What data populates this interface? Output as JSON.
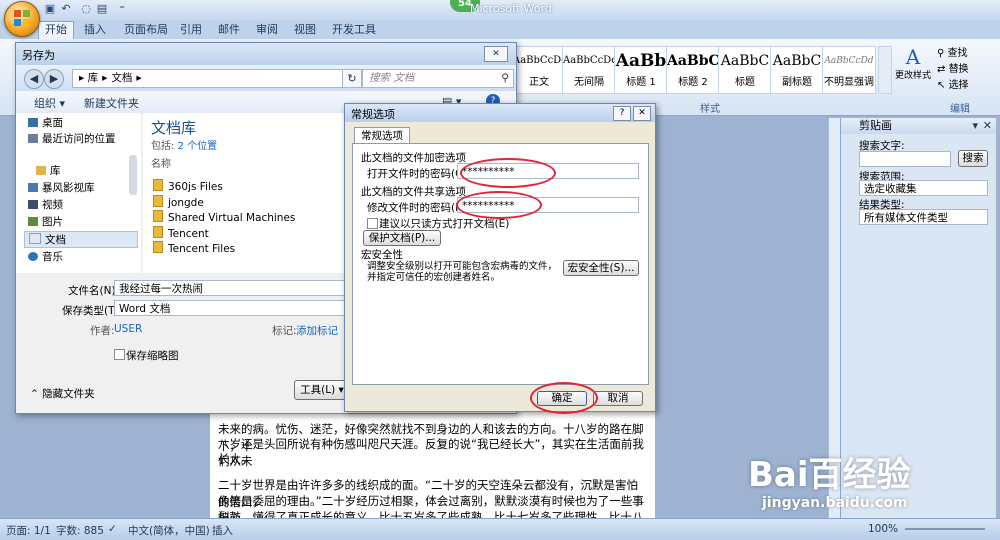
{
  "app": {
    "title": "Microsoft Word",
    "badge": "54"
  },
  "ribbon": {
    "tabs": [
      "开始",
      "插入",
      "页面布局",
      "引用",
      "邮件",
      "审阅",
      "视图",
      "开发工具"
    ],
    "styles": [
      {
        "sample": "AaBbCcDd",
        "name": "正文"
      },
      {
        "sample": "AaBbCcDd",
        "name": "无间隔"
      },
      {
        "sample": "AaBb",
        "name": "标题 1"
      },
      {
        "sample": "AaBbC",
        "name": "标题 2"
      },
      {
        "sample": "AaBbC",
        "name": "标题"
      },
      {
        "sample": "AaBbC",
        "name": "副标题"
      },
      {
        "sample": "AaBbCcDd",
        "name": "不明显强调"
      }
    ],
    "change_styles": "更改样式",
    "styles_group": "样式",
    "edit_group": "编辑",
    "find": "查找",
    "replace": "替换",
    "select": "选择"
  },
  "saveas": {
    "title": "另存为",
    "breadcrumb": [
      "库",
      "文档"
    ],
    "search_placeholder": "搜索 文档",
    "organize": "组织",
    "new_folder": "新建文件夹",
    "tree": [
      "桌面",
      "最近访问的位置",
      "库",
      "暴风影视库",
      "视频",
      "图片",
      "文档",
      "音乐"
    ],
    "library_title": "文档库",
    "library_sub_prefix": "包括:",
    "library_sub_link": "2 个位置",
    "column_name": "名称",
    "folders": [
      "360js Files",
      "jongde",
      "Shared Virtual Machines",
      "Tencent",
      "Tencent Files"
    ],
    "filename_label": "文件名(N):",
    "filename_value": "我经过每一次热闹",
    "filetype_label": "保存类型(T):",
    "filetype_value": "Word 文档",
    "author_label": "作者:",
    "author_value": "USER",
    "tags_label": "标记:",
    "tags_value": "添加标记",
    "thumbnail": "保存缩略图",
    "hide_folders": "隐藏文件夹",
    "tools": "工具(L)"
  },
  "options": {
    "title": "常规选项",
    "tab": "常规选项",
    "enc_section": "此文档的文件加密选项",
    "open_pw_label": "打开文件时的密码(O):",
    "open_pw_value": "**********",
    "share_section": "此文档的文件共享选项",
    "modify_pw_label": "修改文件时的密码(M):",
    "modify_pw_value": "**********",
    "readonly": "建议以只读方式打开文档(E)",
    "protect_btn": "保护文档(P)...",
    "macro_section": "宏安全性",
    "macro_text": "调整安全级别以打开可能包含宏病毒的文件，并指定可信任的宏创建者姓名。",
    "macro_btn": "宏安全性(S)...",
    "ok": "确定",
    "cancel": "取消"
  },
  "clipboard": {
    "title": "剪贴画",
    "search_label": "搜索文字:",
    "search_btn": "搜索",
    "scope_label": "搜索范围:",
    "scope_value": "选定收藏集",
    "type_label": "结果类型:",
    "type_value": "所有媒体文件类型"
  },
  "document": {
    "line0": "未来的病。忧伤、迷茫，好像突然就找不到身边的人和该去的方向。十八岁的路在脚下，十",
    "line1": "八岁还是头回所说有种伤感叫咫尺天涯。反复的说“我已经长大”，其实在生活面前我们从未",
    "line2": "长大。",
    "line3": "二十岁世界是由许许多多的线织成的面。“二十岁的天空连朵云都没有，沉默是害怕的借口，",
    "line4": "像笑是委屈的理由。”二十岁经历过相聚，体会过离别，默默淡漠有时候也为了一些事担心",
    "line5": "裂鼓，懂得了真正成长的意义。比十五岁多了些成熟，比十七岁多了些理性，比十八岁多了"
  },
  "status": {
    "page": "页面: 1/1",
    "words": "字数: 885",
    "lang": "中文(简体，中国)",
    "insert": "插入",
    "zoom": "100%"
  },
  "watermark": {
    "brand": "Bai百经验",
    "url": "jingyan.baidu.com"
  }
}
